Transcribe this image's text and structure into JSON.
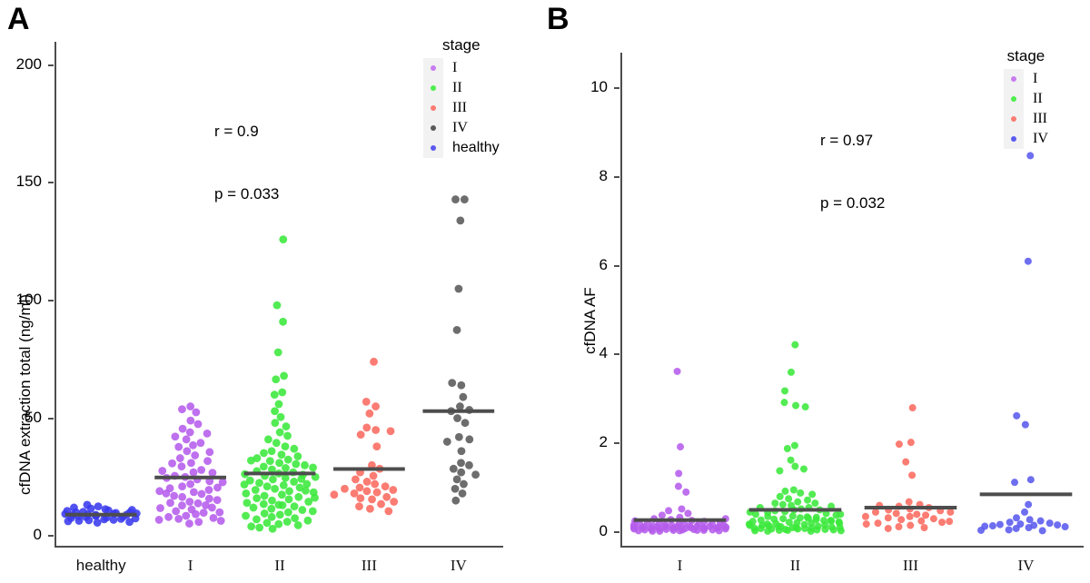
{
  "figure": {
    "panels": [
      {
        "letter": "A",
        "stat_r": "r = 0.9",
        "stat_p": "p = 0.033",
        "y_axis_label": "cfDNA extraction total (ng/ml)",
        "x_axis_label": "",
        "y_ticks": [
          "0",
          "50",
          "100",
          "150",
          "200"
        ],
        "x_ticks": [
          "healthy",
          "I",
          "II",
          "III",
          "IV"
        ],
        "legend": {
          "title": "stage",
          "items": [
            {
              "label": "I",
              "color": "#C77CEF",
              "serif": true
            },
            {
              "label": "II",
              "color": "#4DEE4D",
              "serif": true
            },
            {
              "label": "III",
              "color": "#FA7B72",
              "serif": true
            },
            {
              "label": "IV",
              "color": "#595959",
              "serif": true
            },
            {
              "label": "healthy",
              "color": "#5A5AEE",
              "serif": false
            }
          ]
        }
      },
      {
        "letter": "B",
        "stat_r": "r = 0.97",
        "stat_p": "p = 0.032",
        "y_axis_label": "cfDNA AF",
        "x_axis_label": "",
        "y_ticks": [
          "0",
          "2",
          "4",
          "6",
          "8",
          "10"
        ],
        "x_ticks": [
          "I",
          "II",
          "III",
          "IV"
        ],
        "legend": {
          "title": "stage",
          "items": [
            {
              "label": "I",
              "color": "#C77CEF",
              "serif": true
            },
            {
              "label": "II",
              "color": "#4DEE4D",
              "serif": true
            },
            {
              "label": "III",
              "color": "#FA7B72",
              "serif": true
            },
            {
              "label": "IV",
              "color": "#5A5AEE",
              "serif": true
            }
          ]
        }
      }
    ]
  },
  "chart_data": [
    {
      "type": "scatter",
      "panel": "A",
      "title": "",
      "xlabel": "",
      "ylabel": "cfDNA extraction total (ng/ml)",
      "ylim": [
        -5,
        210
      ],
      "yticks": [
        0,
        50,
        100,
        150,
        200
      ],
      "grid": false,
      "legend_position": "top-right",
      "annotations": [
        "r = 0.9",
        "p = 0.033"
      ],
      "categories": [
        "healthy",
        "I",
        "II",
        "III",
        "IV"
      ],
      "medians": [
        9.0,
        24.8,
        26.5,
        28.4,
        53.0
      ],
      "series": [
        {
          "name": "healthy",
          "color": "#3A3AEE",
          "values": [
            8.5,
            7.0,
            9.4,
            10.2,
            12.5,
            8.1,
            9.9,
            6.6,
            11.3,
            8.8,
            7.4,
            13.2,
            9.1,
            10.6,
            6.2,
            8.3,
            9.7,
            7.8,
            11.0,
            5.9,
            8.9,
            10.0,
            6.8,
            9.3,
            7.2,
            12.0,
            8.6,
            9.5,
            6.4,
            10.8,
            8.0,
            7.6,
            9.0,
            11.6,
            5.6
          ]
        },
        {
          "name": "I",
          "color": "#B55CEC",
          "values": [
            55.0,
            52.5,
            49.0,
            53.8,
            47.5,
            44.0,
            41.0,
            38.5,
            42.2,
            36.0,
            39.5,
            34.2,
            43.5,
            31.0,
            37.8,
            33.0,
            29.5,
            35.6,
            28.0,
            30.8,
            27.0,
            25.5,
            26.8,
            24.0,
            25.0,
            23.2,
            22.0,
            24.6,
            21.0,
            20.2,
            19.5,
            18.6,
            17.8,
            19.0,
            16.5,
            17.0,
            15.8,
            14.5,
            15.2,
            13.8,
            12.9,
            14.0,
            12.0,
            11.2,
            13.0,
            10.5,
            11.8,
            9.8,
            10.0,
            8.5,
            9.2,
            7.6,
            8.0,
            6.8,
            7.2,
            5.9,
            6.4,
            5.2,
            22.8,
            18.0,
            31.8,
            27.6,
            45.5,
            20.5
          ]
        },
        {
          "name": "II",
          "color": "#3BE83B",
          "values": [
            126.0,
            98.0,
            91.0,
            78.0,
            68.0,
            66.5,
            61.0,
            60.0,
            56.0,
            53.0,
            50.5,
            48.0,
            46.5,
            44.0,
            42.5,
            41.0,
            39.5,
            38.0,
            37.0,
            36.0,
            35.2,
            34.5,
            33.8,
            33.0,
            32.4,
            31.8,
            31.0,
            30.5,
            30.0,
            29.4,
            28.8,
            28.2,
            27.5,
            27.0,
            26.5,
            26.0,
            25.5,
            25.0,
            24.6,
            24.0,
            23.5,
            23.0,
            22.5,
            22.0,
            21.5,
            21.0,
            20.5,
            20.0,
            19.5,
            19.0,
            18.5,
            18.0,
            17.5,
            17.0,
            16.5,
            16.0,
            15.5,
            15.0,
            14.5,
            14.0,
            13.5,
            13.0,
            12.5,
            12.0,
            11.5,
            11.0,
            10.5,
            10.0,
            9.5,
            9.0,
            8.5,
            8.0,
            7.5,
            7.0,
            6.5,
            6.0,
            5.5,
            5.0,
            4.5,
            4.0,
            3.5,
            3.0,
            29.0,
            32.0,
            26.2,
            24.2,
            21.8,
            19.2,
            16.2,
            13.2
          ]
        },
        {
          "name": "III",
          "color": "#FB6A60",
          "values": [
            74.0,
            57.0,
            55.0,
            52.0,
            46.0,
            45.0,
            44.5,
            43.0,
            38.0,
            30.0,
            28.5,
            27.0,
            25.5,
            24.0,
            23.0,
            22.0,
            21.0,
            20.5,
            20.0,
            19.5,
            19.0,
            18.5,
            18.0,
            17.5,
            16.5,
            16.0,
            15.5,
            14.5,
            13.5,
            12.5,
            11.5,
            10.5
          ]
        },
        {
          "name": "IV",
          "color": "#595959",
          "values": [
            143.0,
            143.0,
            134.0,
            105.0,
            87.5,
            65.0,
            64.0,
            59.0,
            55.0,
            53.5,
            53.0,
            50.0,
            48.0,
            42.0,
            41.0,
            40.0,
            36.0,
            31.0,
            30.0,
            28.5,
            27.0,
            26.0,
            24.0,
            22.0,
            20.0,
            18.0,
            15.0
          ]
        }
      ]
    },
    {
      "type": "scatter",
      "panel": "B",
      "title": "",
      "xlabel": "",
      "ylabel": "cfDNA AF",
      "ylim": [
        -0.35,
        10.8
      ],
      "yticks": [
        0,
        2,
        4,
        6,
        8,
        10
      ],
      "grid": false,
      "legend_position": "top-right",
      "annotations": [
        "r = 0.97",
        "p = 0.032"
      ],
      "categories": [
        "I",
        "II",
        "III",
        "IV"
      ],
      "medians": [
        0.27,
        0.5,
        0.55,
        0.85
      ],
      "series": [
        {
          "name": "I",
          "color": "#B55CEC",
          "values": [
            3.62,
            1.92,
            1.32,
            1.03,
            0.9,
            0.52,
            0.48,
            0.42,
            0.38,
            0.33,
            0.3,
            0.28,
            0.26,
            0.24,
            0.22,
            0.21,
            0.2,
            0.19,
            0.18,
            0.18,
            0.17,
            0.17,
            0.16,
            0.16,
            0.15,
            0.15,
            0.14,
            0.14,
            0.13,
            0.13,
            0.12,
            0.12,
            0.12,
            0.11,
            0.11,
            0.11,
            0.1,
            0.1,
            0.1,
            0.09,
            0.09,
            0.09,
            0.08,
            0.08,
            0.08,
            0.07,
            0.07,
            0.07,
            0.06,
            0.06,
            0.06,
            0.05,
            0.05,
            0.05,
            0.04,
            0.04,
            0.04,
            0.03,
            0.03,
            0.03,
            0.02,
            0.02,
            0.3,
            0.25
          ]
        },
        {
          "name": "II",
          "color": "#3BE83B",
          "values": [
            4.22,
            3.6,
            3.18,
            2.92,
            2.85,
            2.82,
            1.95,
            1.88,
            1.62,
            1.48,
            1.42,
            1.38,
            0.95,
            0.92,
            0.88,
            0.85,
            0.8,
            0.75,
            0.72,
            0.68,
            0.65,
            0.62,
            0.6,
            0.58,
            0.55,
            0.52,
            0.5,
            0.48,
            0.46,
            0.44,
            0.42,
            0.4,
            0.38,
            0.36,
            0.34,
            0.32,
            0.3,
            0.29,
            0.28,
            0.27,
            0.26,
            0.25,
            0.24,
            0.23,
            0.22,
            0.21,
            0.2,
            0.19,
            0.18,
            0.17,
            0.16,
            0.15,
            0.14,
            0.13,
            0.12,
            0.11,
            0.1,
            0.1,
            0.09,
            0.09,
            0.08,
            0.08,
            0.07,
            0.07,
            0.06,
            0.06,
            0.05,
            0.05,
            0.04,
            0.04,
            0.03,
            0.03,
            0.02,
            0.02,
            0.35,
            0.33,
            0.31,
            0.45,
            0.55,
            0.65,
            0.2,
            0.26,
            0.18,
            0.15,
            0.12,
            0.1,
            0.4,
            0.5
          ]
        },
        {
          "name": "III",
          "color": "#FB6A60",
          "values": [
            2.8,
            2.02,
            1.98,
            1.58,
            1.28,
            0.68,
            0.62,
            0.58,
            0.55,
            0.52,
            0.5,
            0.48,
            0.45,
            0.42,
            0.4,
            0.38,
            0.35,
            0.32,
            0.3,
            0.28,
            0.25,
            0.22,
            0.2,
            0.18,
            0.15,
            0.12,
            0.1,
            0.08,
            0.6,
            0.35,
            0.45,
            0.24
          ]
        },
        {
          "name": "IV",
          "color": "#5A5AEE",
          "values": [
            8.48,
            6.1,
            2.62,
            2.42,
            1.18,
            1.12,
            0.62,
            0.45,
            0.32,
            0.28,
            0.25,
            0.22,
            0.2,
            0.18,
            0.17,
            0.16,
            0.15,
            0.14,
            0.13,
            0.12,
            0.1,
            0.08,
            0.05,
            0.04,
            0.03
          ]
        }
      ]
    }
  ]
}
